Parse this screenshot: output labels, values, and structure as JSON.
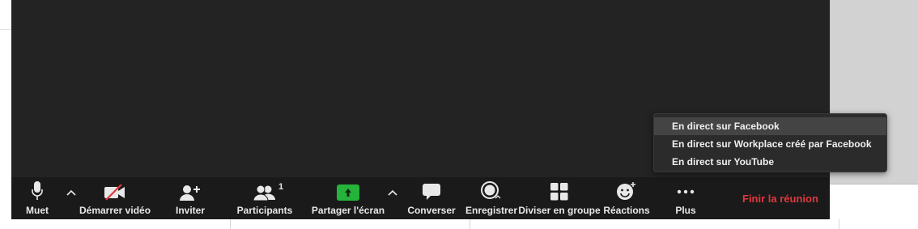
{
  "toolbar": {
    "mute_label": "Muet",
    "video_label": "Démarrer vidéo",
    "invite_label": "Inviter",
    "participants_label": "Participants",
    "participants_count": "1",
    "share_label": "Partager l'écran",
    "chat_label": "Converser",
    "record_label": "Enregistrer",
    "breakout_label": "Diviser en groupe",
    "reactions_label": "Réactions",
    "more_label": "Plus",
    "end_label": "Finir la réunion"
  },
  "more_menu": {
    "items": [
      "En direct sur Facebook",
      "En direct sur Workplace créé par Facebook",
      "En direct sur YouTube"
    ],
    "highlighted_index": 0
  },
  "colors": {
    "toolbar_bg": "#1a1a1a",
    "video_bg": "#232323",
    "end_red": "#e0383e",
    "share_green": "#25b33b",
    "icon_white": "#e8e8e8",
    "video_off_red": "#e0383e"
  },
  "icons": {
    "mute": "microphone-icon",
    "video": "video-camera-off-icon",
    "invite": "add-user-icon",
    "participants": "users-icon",
    "share": "share-screen-arrow-icon",
    "chat": "speech-bubble-icon",
    "record": "record-circle-icon",
    "breakout": "grid-four-squares-icon",
    "reactions": "smiley-plus-icon",
    "more": "ellipsis-icon"
  }
}
